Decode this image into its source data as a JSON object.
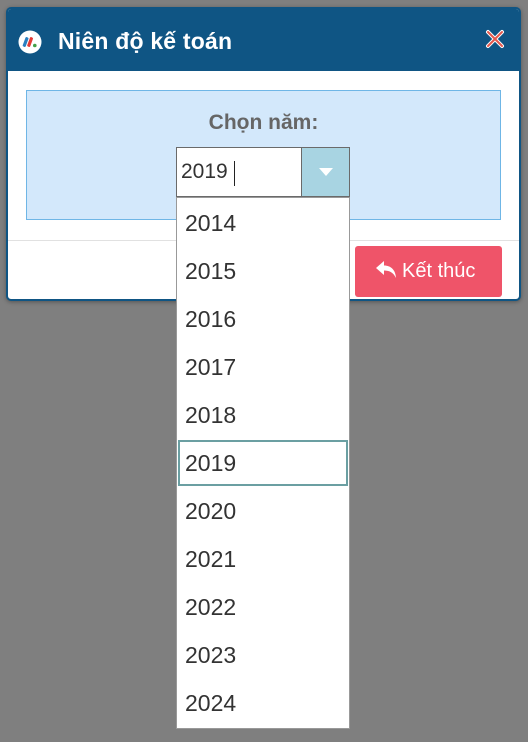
{
  "dialog": {
    "title": "Niên độ kế toán",
    "close_icon": "close-icon",
    "app_icon": "app-logo-icon"
  },
  "year_picker": {
    "label": "Chọn năm:",
    "value": "2019",
    "options": [
      "2014",
      "2015",
      "2016",
      "2017",
      "2018",
      "2019",
      "2020",
      "2021",
      "2022",
      "2023",
      "2024"
    ],
    "selected_index": 5
  },
  "footer": {
    "exit_label": "Kết thúc",
    "exit_icon": "undo-arrow-icon"
  },
  "colors": {
    "title_bar": "#0f5584",
    "panel_bg": "#d3e8fb",
    "panel_border": "#6fb6e6",
    "exit_button": "#ef5469",
    "dropdown_toggle": "#a8d4e2",
    "backdrop": "#7f7f7f"
  }
}
